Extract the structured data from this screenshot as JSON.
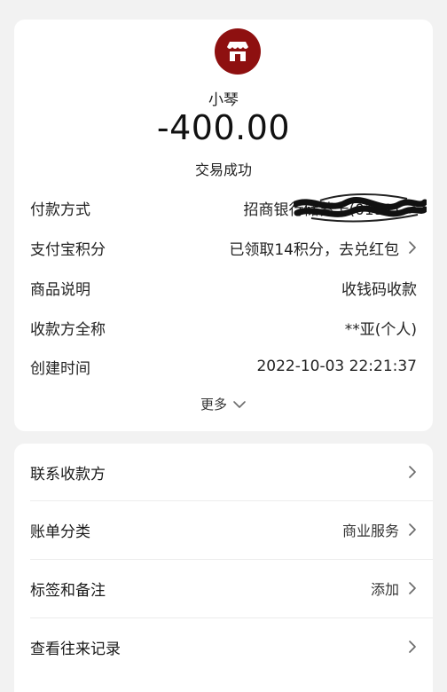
{
  "merchant": {
    "name": "小琴",
    "avatar_color": "#8e1010",
    "avatar_icon": "store-icon"
  },
  "transaction": {
    "amount": "-400.00",
    "status": "交易成功"
  },
  "details": [
    {
      "label": "付款方式",
      "value": "招商银行储蓄卡(0192)",
      "has_chevron": true,
      "obscured": true
    },
    {
      "label": "支付宝积分",
      "value": "已领取14积分，去兑红包",
      "has_chevron": true
    },
    {
      "label": "商品说明",
      "value": "收钱码收款",
      "has_chevron": false
    },
    {
      "label": "收款方全称",
      "value": "**亚(个人)",
      "has_chevron": false
    },
    {
      "label": "创建时间",
      "value": "2022-10-03 22:21:37",
      "has_chevron": false
    }
  ],
  "more_label": "更多",
  "actions": [
    {
      "label": "联系收款方",
      "value": ""
    },
    {
      "label": "账单分类",
      "value": "商业服务"
    },
    {
      "label": "标签和备注",
      "value": "添加"
    },
    {
      "label": "查看往来记录",
      "value": ""
    }
  ]
}
